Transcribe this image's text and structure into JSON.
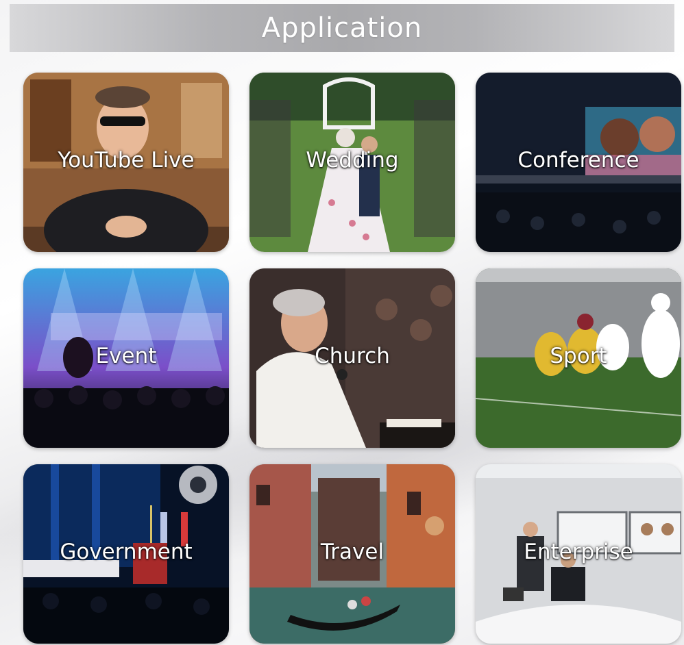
{
  "header": {
    "title": "Application"
  },
  "tiles": [
    {
      "label": "YouTube Live"
    },
    {
      "label": "Wedding"
    },
    {
      "label": "Conference"
    },
    {
      "label": "Event"
    },
    {
      "label": "Church"
    },
    {
      "label": "Sport"
    },
    {
      "label": "Government"
    },
    {
      "label": "Travel"
    },
    {
      "label": "Enterprise"
    }
  ]
}
